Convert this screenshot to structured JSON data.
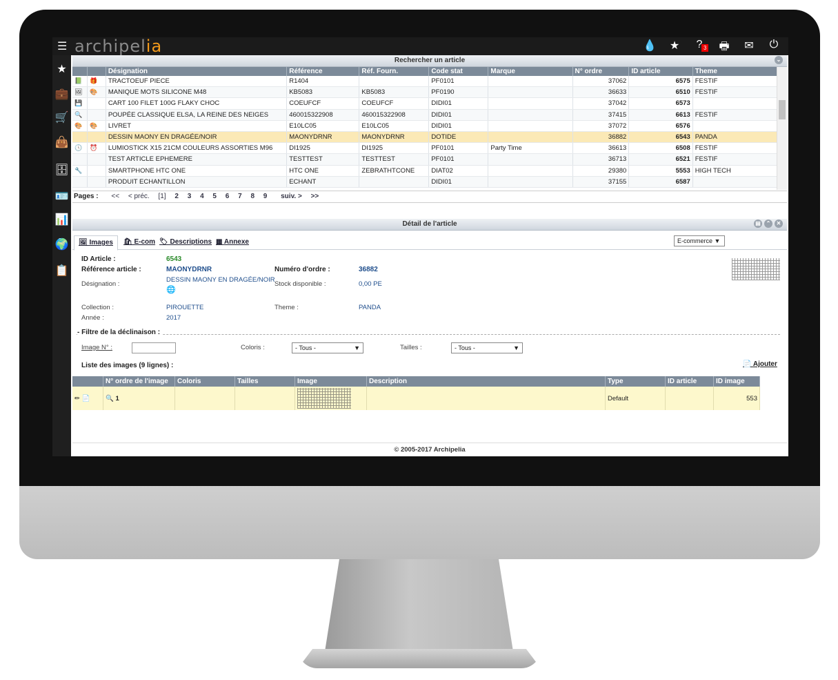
{
  "app": {
    "logo_main": "archipel",
    "logo_accent": "ia"
  },
  "topbar": {
    "icons": [
      "drop-icon",
      "star-icon",
      "help-icon",
      "printer-icon",
      "mail-icon",
      "power-icon"
    ],
    "help_badge": "3"
  },
  "sidebar": {
    "icons": [
      "star-icon",
      "briefcase-icon",
      "cart-icon",
      "bag-icon",
      "database-icon",
      "contact-card-icon",
      "bar-chart-icon",
      "globe-icon",
      "clipboard-icon"
    ]
  },
  "search_panel": {
    "title": "Rechercher un article",
    "columns": [
      "Désignation",
      "Référence",
      "Réf. Fourn.",
      "Code stat",
      "Marque",
      "N° ordre",
      "ID article",
      "Theme"
    ],
    "rows": [
      {
        "designation": "TRACTOEUF PIECE",
        "reference": "R1404",
        "ref_fourn": "",
        "code_stat": "PF0101",
        "marque": "",
        "ordre": "37062",
        "id": "6575",
        "theme": "FESTIF"
      },
      {
        "designation": "MANIQUE MOTS SILICONE M48",
        "reference": "KB5083",
        "ref_fourn": "KB5083",
        "code_stat": "PF0190",
        "marque": "",
        "ordre": "36633",
        "id": "6510",
        "theme": "FESTIF"
      },
      {
        "designation": "CART 100 FILET 100G FLAKY CHOC",
        "reference": "COEUFCF",
        "ref_fourn": "COEUFCF",
        "code_stat": "DIDI01",
        "marque": "",
        "ordre": "37042",
        "id": "6573",
        "theme": ""
      },
      {
        "designation": "POUPÉE CLASSIQUE ELSA, LA REINE DES NEIGES",
        "reference": "460015322908",
        "ref_fourn": "460015322908",
        "code_stat": "DIDI01",
        "marque": "",
        "ordre": "37415",
        "id": "6613",
        "theme": "FESTIF"
      },
      {
        "designation": "LIVRET",
        "reference": "E10LC05",
        "ref_fourn": "E10LC05",
        "code_stat": "DIDI01",
        "marque": "",
        "ordre": "37072",
        "id": "6576",
        "theme": ""
      },
      {
        "designation": "DESSIN MAONY EN DRAGÉE/NOIR",
        "reference": "MAONYDRNR",
        "ref_fourn": "MAONYDRNR",
        "code_stat": "DOTIDE",
        "marque": "",
        "ordre": "36882",
        "id": "6543",
        "theme": "PANDA"
      },
      {
        "designation": "LUMIOSTICK X15 21CM COULEURS ASSORTIES M96",
        "reference": "DI1925",
        "ref_fourn": "DI1925",
        "code_stat": "PF0101",
        "marque": "Party Time",
        "ordre": "36613",
        "id": "6508",
        "theme": "FESTIF"
      },
      {
        "designation": "TEST ARTICLE EPHEMERE",
        "reference": "TESTTEST",
        "ref_fourn": "TESTTEST",
        "code_stat": "PF0101",
        "marque": "",
        "ordre": "36713",
        "id": "6521",
        "theme": "FESTIF"
      },
      {
        "designation": "SMARTPHONE HTC ONE",
        "reference": "HTC ONE",
        "ref_fourn": "ZEBRATHTCONE",
        "code_stat": "DIAT02",
        "marque": "",
        "ordre": "29380",
        "id": "5553",
        "theme": "HIGH TECH"
      },
      {
        "designation": "PRODUIT ECHANTILLON",
        "reference": "ECHANT",
        "ref_fourn": "",
        "code_stat": "DIDI01",
        "marque": "",
        "ordre": "37155",
        "id": "6587",
        "theme": ""
      }
    ],
    "pager": {
      "label": "Pages :",
      "first": "<<",
      "prev": "< préc.",
      "current": "[1]",
      "pages": [
        "2",
        "3",
        "4",
        "5",
        "6",
        "7",
        "8",
        "9"
      ],
      "next": "suiv. >",
      "last": ">>"
    }
  },
  "detail_panel": {
    "title": "Détail de l'article",
    "tabs": [
      "Images",
      "E-com",
      "Descriptions",
      "Annexe"
    ],
    "channel_select": "E-commerce",
    "id_article_label": "ID Article :",
    "id_article": "6543",
    "ref_label": "Référence article :",
    "ref": "MAONYDRNR",
    "ordre_label": "Numéro d'ordre :",
    "ordre": "36882",
    "designation_label": "Désignation :",
    "designation": "DESSIN MAONY EN DRAGÉE/NOIR",
    "stock_label": "Stock disponible :",
    "stock": "0,00 PE",
    "collection_label": "Collection :",
    "collection": "PIROUETTE",
    "theme_label": "Theme :",
    "theme": "PANDA",
    "annee_label": "Année :",
    "annee": "2017",
    "filter_title": "- Filtre de la déclinaison :",
    "image_no_label": "Image N° :",
    "coloris_label": "Coloris :",
    "coloris_value": "- Tous -",
    "tailles_label": "Tailles :",
    "tailles_value": "- Tous -",
    "list_title": "Liste des images (9 lignes) :",
    "add_label": "Ajouter",
    "img_columns": [
      "N° ordre de l'image",
      "Coloris",
      "Tailles",
      "Image",
      "Description",
      "Type",
      "ID article",
      "ID image"
    ],
    "img_row": {
      "ordre": "1",
      "coloris": "",
      "tailles": "",
      "description": "",
      "type": "Default",
      "id_article": "",
      "id_image": "553"
    }
  },
  "footer": "© 2005-2017 Archipelia"
}
